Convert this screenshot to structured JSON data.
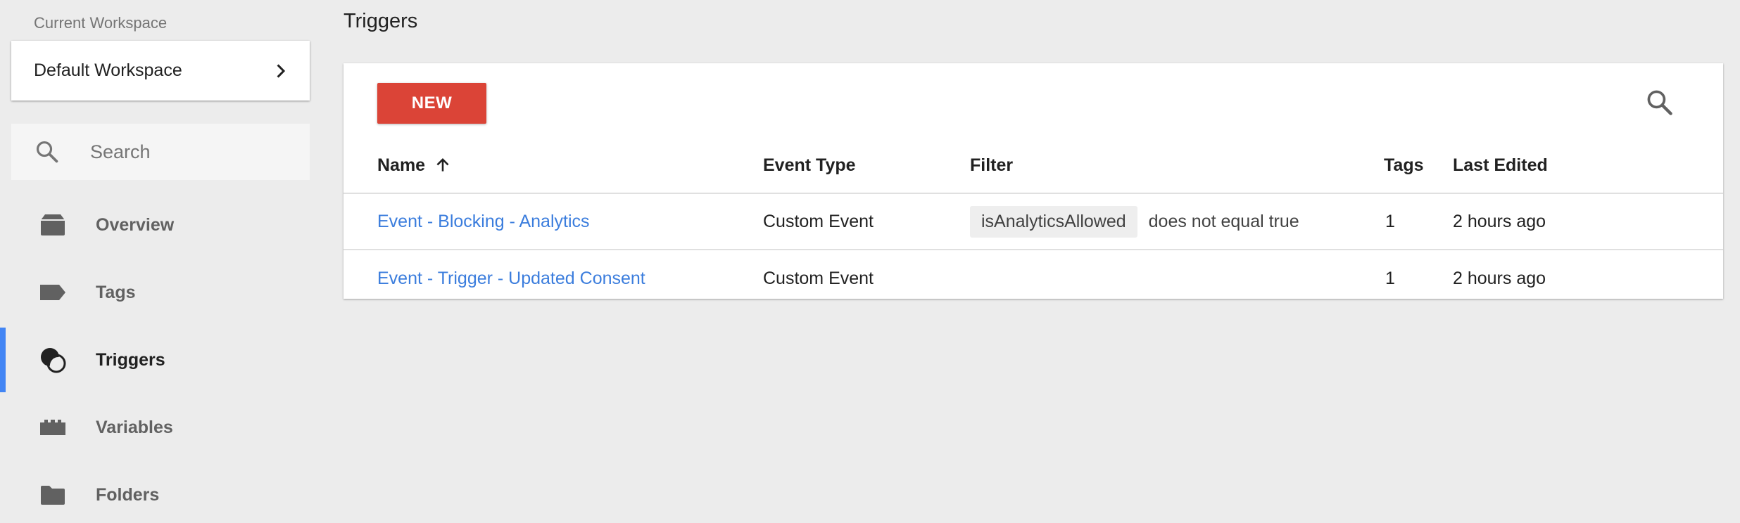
{
  "sidebar": {
    "workspace_caption": "Current Workspace",
    "workspace_name": "Default Workspace",
    "search_placeholder": "Search",
    "nav": [
      {
        "label": "Overview",
        "icon": "overview-icon"
      },
      {
        "label": "Tags",
        "icon": "tag-icon"
      },
      {
        "label": "Triggers",
        "icon": "trigger-icon",
        "active": true
      },
      {
        "label": "Variables",
        "icon": "variables-icon"
      },
      {
        "label": "Folders",
        "icon": "folder-icon"
      }
    ]
  },
  "main": {
    "title": "Triggers",
    "new_button": "NEW",
    "columns": {
      "name": "Name",
      "event_type": "Event Type",
      "filter": "Filter",
      "tags": "Tags",
      "last_edited": "Last Edited"
    },
    "rows": [
      {
        "name": "Event - Blocking - Analytics",
        "event_type": "Custom Event",
        "filter_variable": "isAnalyticsAllowed",
        "filter_condition": "does not equal true",
        "tags": "1",
        "last_edited": "2 hours ago"
      },
      {
        "name": "Event - Trigger - Updated Consent",
        "event_type": "Custom Event",
        "filter_variable": "",
        "filter_condition": "",
        "tags": "1",
        "last_edited": "2 hours ago"
      }
    ]
  },
  "colors": {
    "accent_blue": "#4285f4",
    "new_button_red": "#db4437",
    "link_blue": "#3b7ddd",
    "background": "#ececec"
  }
}
